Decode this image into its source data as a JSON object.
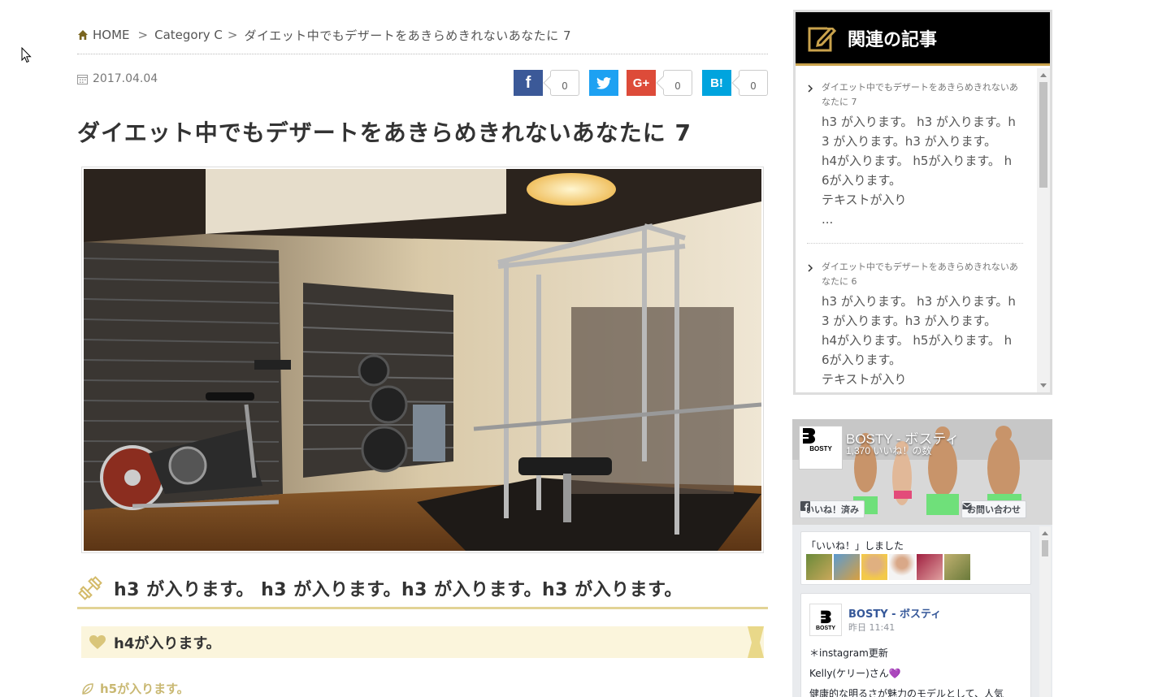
{
  "breadcrumb": {
    "home": "HOME",
    "sep1": ">",
    "category": "Category C",
    "sep2": ">",
    "current": "ダイエット中でもデザートをあきらめきれないあなたに 7"
  },
  "post": {
    "date": "2017.04.04",
    "title": "ダイエット中でもデザートをあきらめきれないあなたに 7",
    "h3": "h3 が入ります。 h3 が入ります。h3 が入ります。h3 が入ります。",
    "h4": "h4が入ります。",
    "h5": "h5が入ります。"
  },
  "share": {
    "facebook_label": "f",
    "facebook_count": "0",
    "twitter_count": "",
    "googleplus_label": "G+",
    "googleplus_count": "0",
    "hatena_label": "B!",
    "hatena_count": "0"
  },
  "related": {
    "heading": "関連の記事",
    "items": [
      {
        "title": "ダイエット中でもデザートをあきらめきれないあなたに 7",
        "body": [
          "h3 が入ります。 h3 が入ります。h",
          "3 が入ります。h3 が入ります。",
          "h4が入ります。 h5が入ります。 h",
          "6が入ります。",
          "テキストが入り",
          "..."
        ]
      },
      {
        "title": "ダイエット中でもデザートをあきらめきれないあなたに 6",
        "body": [
          "h3 が入ります。 h3 が入ります。h",
          "3 が入ります。h3 が入ります。",
          "h4が入ります。 h5が入ります。 h",
          "6が入ります。",
          "テキストが入り"
        ]
      }
    ]
  },
  "facebook": {
    "page_name": "BOSTY - ボスティ",
    "likes": "1,370 いいね！の数",
    "logo_label": "BOSTY",
    "liked_button": "いいね！済み",
    "contact_button": "お問い合わせ",
    "liked_text": "「いいね！」しました",
    "post": {
      "author": "BOSTY - ボスティ",
      "time": "昨日 11:41",
      "lines": [
        "＊instagram更新",
        "Kelly(ケリー)さん💜",
        "健康的な明るさが魅力のモデルとして、人気"
      ]
    }
  },
  "colors": {
    "accent_gold": "#e2d395",
    "facebook": "#3b5998",
    "twitter": "#1da1f2",
    "googleplus": "#dd4b39",
    "hatena": "#00a4de"
  }
}
